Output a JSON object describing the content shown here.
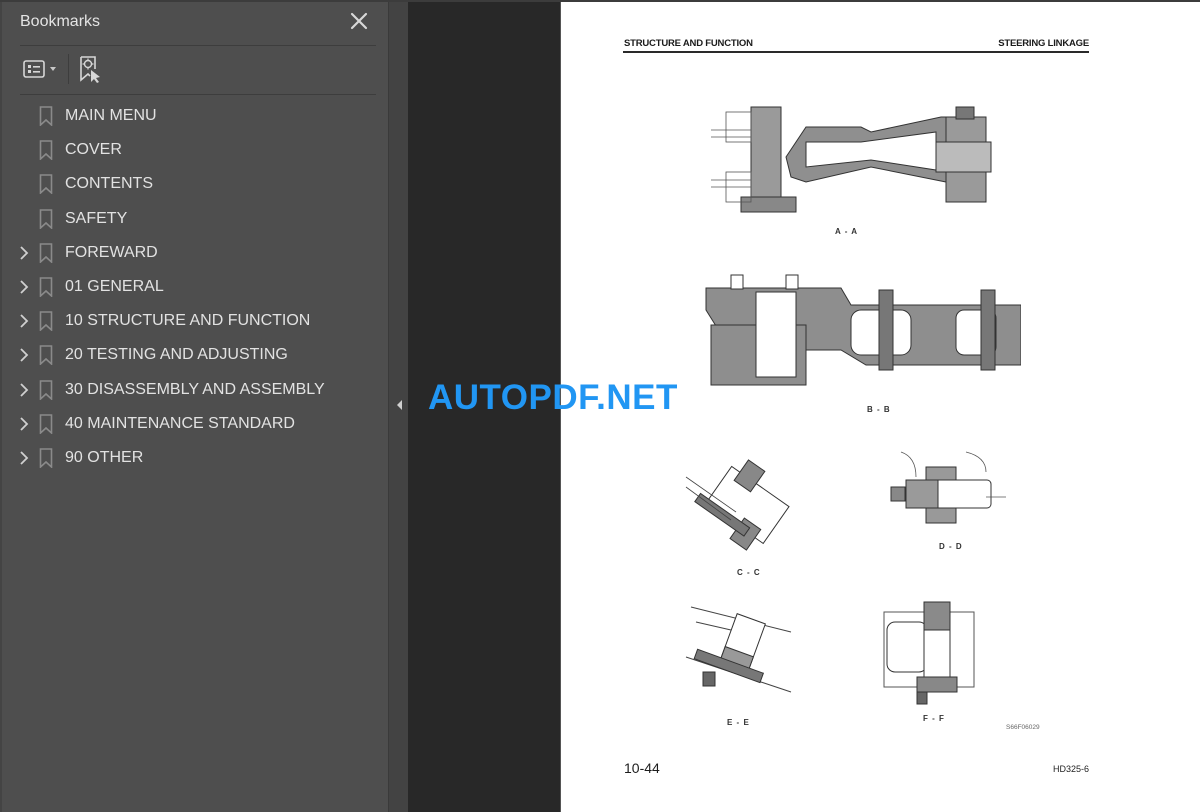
{
  "sidebar": {
    "title": "Bookmarks",
    "close_icon": "close-icon",
    "toolbar": {
      "options_icon": "list-options-icon",
      "find_icon": "find-current-bookmark-icon"
    },
    "bookmarks": [
      {
        "label": "MAIN MENU",
        "expandable": false
      },
      {
        "label": "COVER",
        "expandable": false
      },
      {
        "label": "CONTENTS",
        "expandable": false
      },
      {
        "label": "SAFETY",
        "expandable": false
      },
      {
        "label": "FOREWARD",
        "expandable": true
      },
      {
        "label": "01 GENERAL",
        "expandable": true
      },
      {
        "label": "10 STRUCTURE AND FUNCTION",
        "expandable": true
      },
      {
        "label": "20 TESTING AND ADJUSTING",
        "expandable": true
      },
      {
        "label": "30 DISASSEMBLY AND ASSEMBLY",
        "expandable": true
      },
      {
        "label": "40 MAINTENANCE STANDARD",
        "expandable": true
      },
      {
        "label": "90 OTHER",
        "expandable": true
      }
    ]
  },
  "splitter": {
    "collapse_icon": "collapse-left-icon"
  },
  "page": {
    "header_left": "STRUCTURE AND FUNCTION",
    "header_right": "STEERING LINKAGE",
    "figures": [
      {
        "label": "A - A"
      },
      {
        "label": "B - B"
      },
      {
        "label": "C - C"
      },
      {
        "label": "D - D"
      },
      {
        "label": "E - E"
      },
      {
        "label": "F - F"
      }
    ],
    "figure_code": "S66F06029",
    "page_number": "10-44",
    "model": "HD325-6"
  },
  "watermark": "AUTOPDF.NET",
  "colors": {
    "sidebar_bg": "#4e4e4e",
    "viewer_bg": "#282828",
    "watermark": "#2196f3",
    "text": "#e2e2e2"
  }
}
